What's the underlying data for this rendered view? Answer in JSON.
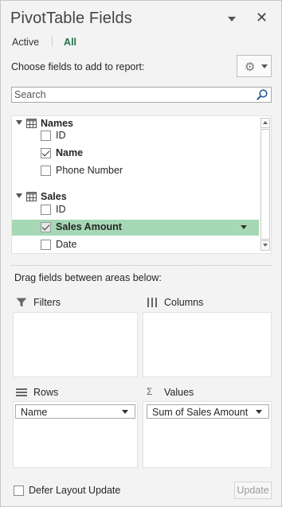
{
  "pane": {
    "title": "PivotTable Fields",
    "close_glyph": "✕",
    "accent_color": "#217346",
    "highlight_color": "#a6d8b5"
  },
  "tabs": [
    {
      "label": "Active",
      "active": false
    },
    {
      "label": "All",
      "active": true
    }
  ],
  "choose_label": "Choose fields to add to report:",
  "search": {
    "placeholder": "Search",
    "value": ""
  },
  "field_list": {
    "tables": [
      {
        "name": "Names",
        "fields": [
          {
            "label": "ID",
            "checked": false
          },
          {
            "label": "Name",
            "checked": true
          },
          {
            "label": "Phone Number",
            "checked": false
          }
        ]
      },
      {
        "name": "Sales",
        "fields": [
          {
            "label": "ID",
            "checked": false
          },
          {
            "label": "Sales Amount",
            "checked": true,
            "highlighted": true
          },
          {
            "label": "Date",
            "checked": false
          }
        ]
      }
    ]
  },
  "drag_label": "Drag fields between areas below:",
  "areas": {
    "filters": {
      "title": "Filters",
      "items": []
    },
    "columns": {
      "title": "Columns",
      "items": []
    },
    "rows": {
      "title": "Rows",
      "items": [
        "Name"
      ]
    },
    "values": {
      "title": "Values",
      "icon_glyph": "Σ",
      "items": [
        "Sum of Sales Amount"
      ]
    }
  },
  "footer": {
    "defer_label": "Defer Layout Update",
    "defer_checked": false,
    "update_label": "Update"
  }
}
